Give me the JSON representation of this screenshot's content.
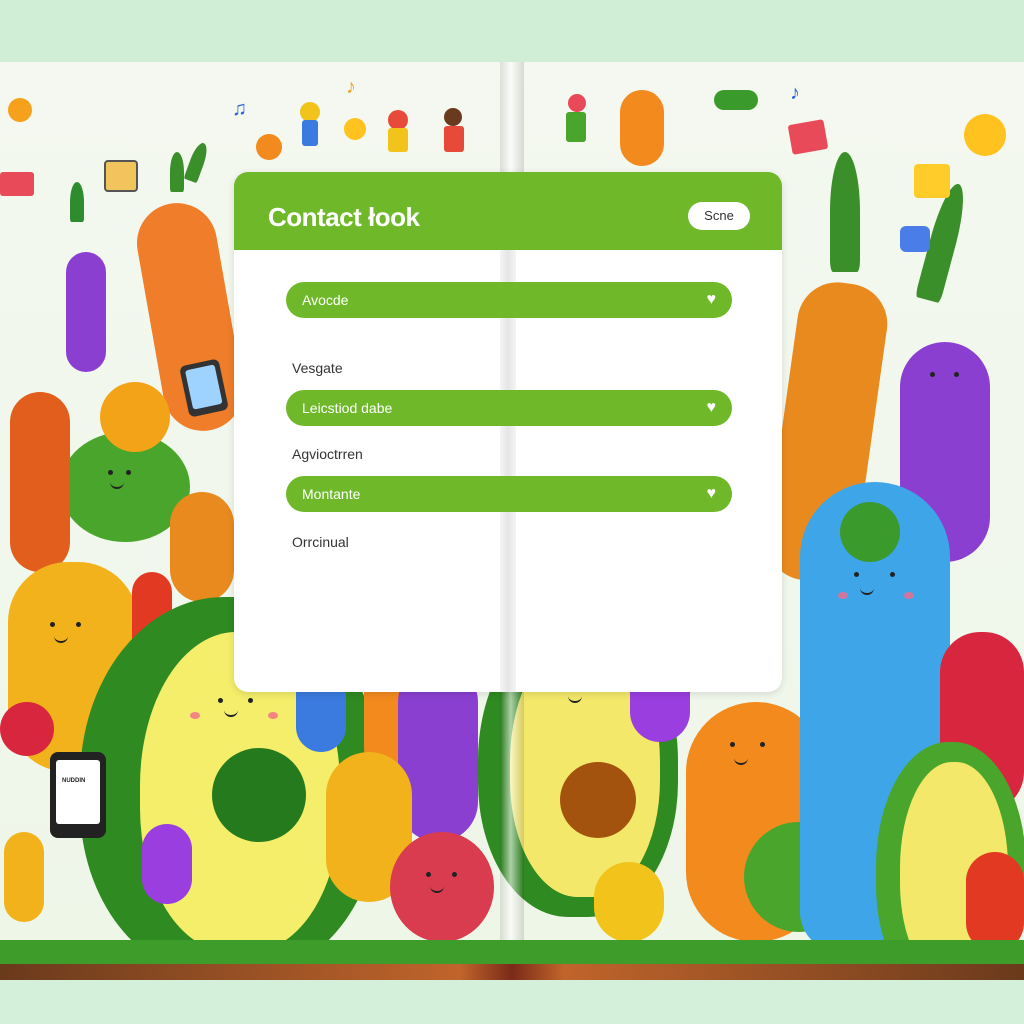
{
  "card": {
    "title": "Contact łook",
    "search_label": "Scne",
    "fields": [
      {
        "text": "Avocde"
      },
      {
        "text": "Leicstiod dabe"
      },
      {
        "text": "Montante"
      }
    ],
    "labels": [
      "Vesgate",
      "Agvioctrren",
      "Orrcinual"
    ]
  },
  "phone_left": {
    "screen_text": "NUDDIN"
  },
  "colors": {
    "header_green": "#6fb82a",
    "page_bg": "#cfeed5",
    "grass": "#3e9d2a"
  },
  "icons": {
    "field_icon": "heart-icon"
  }
}
